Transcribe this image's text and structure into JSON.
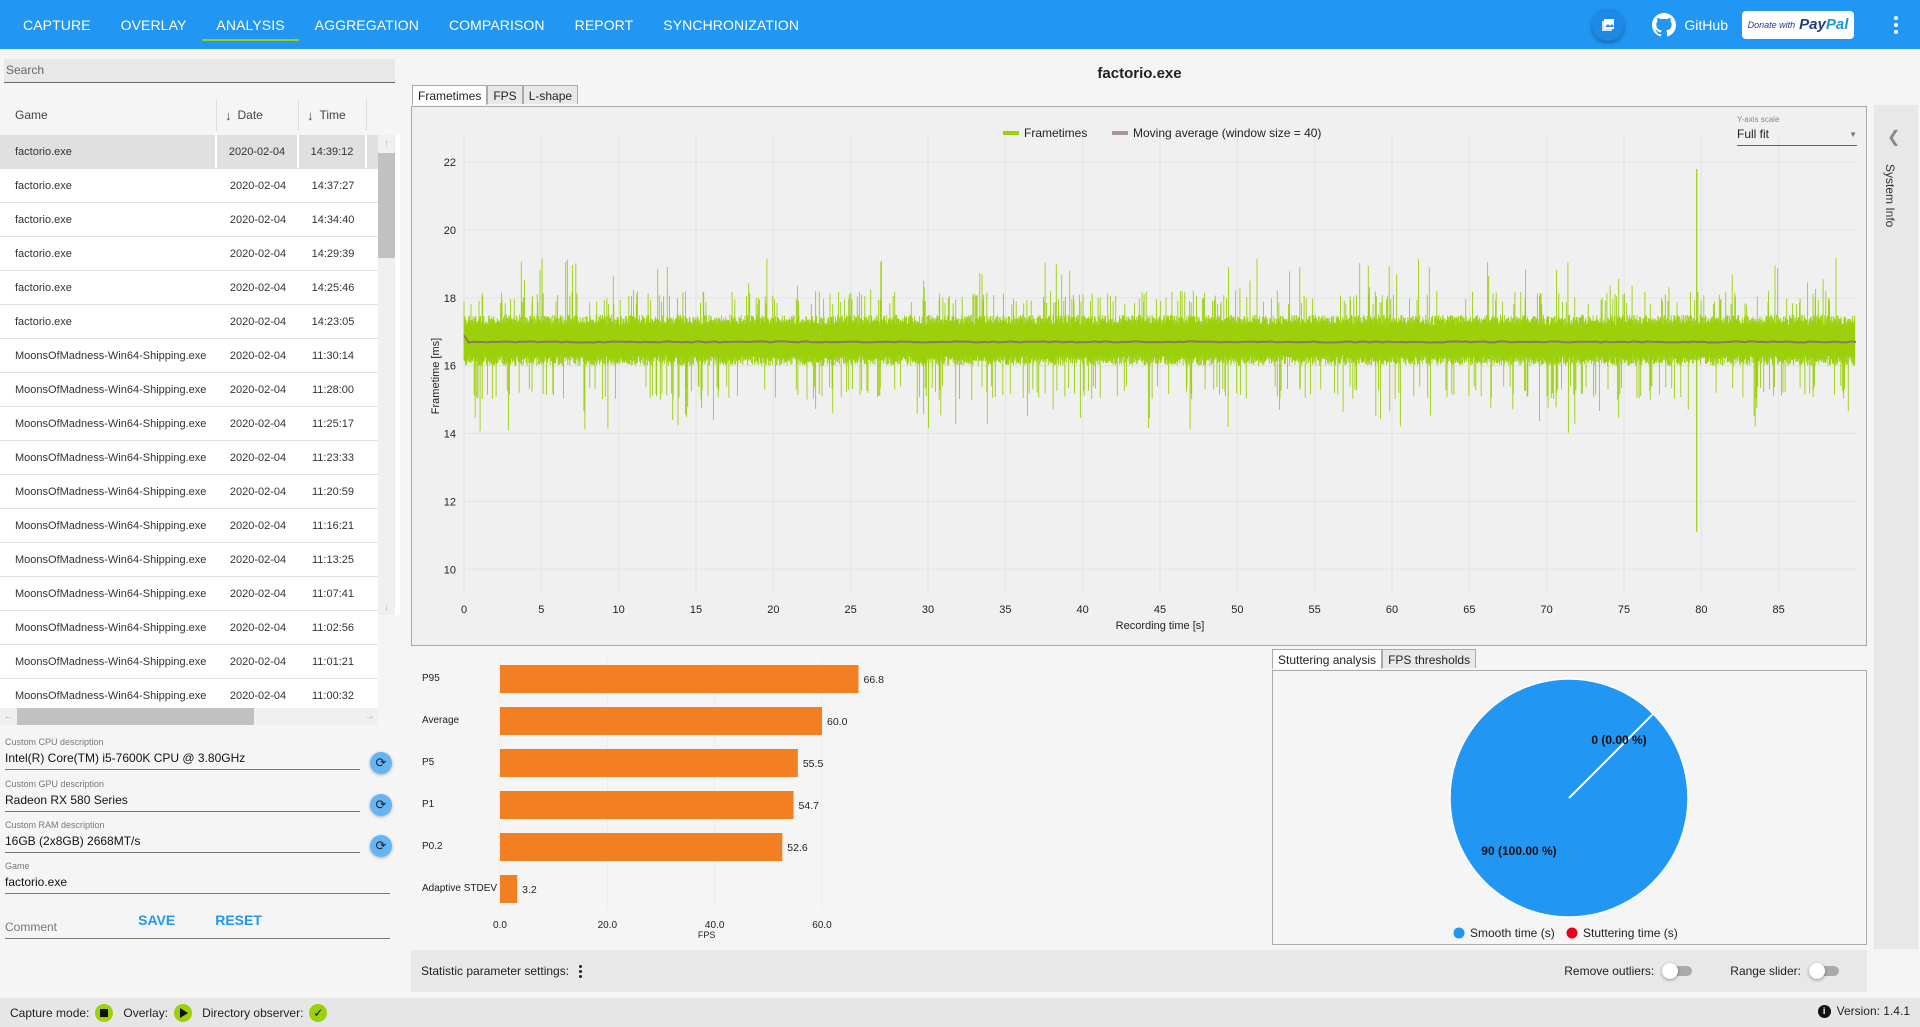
{
  "nav": {
    "items": [
      "CAPTURE",
      "OVERLAY",
      "ANALYSIS",
      "AGGREGATION",
      "COMPARISON",
      "REPORT",
      "SYNCHRONIZATION"
    ],
    "active": "ANALYSIS",
    "github_label": "GitHub",
    "paypal_prefix": "Donate with",
    "paypal_brand_a": "Pay",
    "paypal_brand_b": "Pal"
  },
  "sidebar": {
    "search_placeholder": "Search",
    "columns": {
      "game": "Game",
      "date": "Date",
      "time": "Time"
    },
    "rows": [
      {
        "game": "factorio.exe",
        "date": "2020-02-04",
        "time": "14:39:12",
        "selected": true
      },
      {
        "game": "factorio.exe",
        "date": "2020-02-04",
        "time": "14:37:27"
      },
      {
        "game": "factorio.exe",
        "date": "2020-02-04",
        "time": "14:34:40"
      },
      {
        "game": "factorio.exe",
        "date": "2020-02-04",
        "time": "14:29:39"
      },
      {
        "game": "factorio.exe",
        "date": "2020-02-04",
        "time": "14:25:46"
      },
      {
        "game": "factorio.exe",
        "date": "2020-02-04",
        "time": "14:23:05"
      },
      {
        "game": "MoonsOfMadness-Win64-Shipping.exe",
        "date": "2020-02-04",
        "time": "11:30:14"
      },
      {
        "game": "MoonsOfMadness-Win64-Shipping.exe",
        "date": "2020-02-04",
        "time": "11:28:00"
      },
      {
        "game": "MoonsOfMadness-Win64-Shipping.exe",
        "date": "2020-02-04",
        "time": "11:25:17"
      },
      {
        "game": "MoonsOfMadness-Win64-Shipping.exe",
        "date": "2020-02-04",
        "time": "11:23:33"
      },
      {
        "game": "MoonsOfMadness-Win64-Shipping.exe",
        "date": "2020-02-04",
        "time": "11:20:59"
      },
      {
        "game": "MoonsOfMadness-Win64-Shipping.exe",
        "date": "2020-02-04",
        "time": "11:16:21"
      },
      {
        "game": "MoonsOfMadness-Win64-Shipping.exe",
        "date": "2020-02-04",
        "time": "11:13:25"
      },
      {
        "game": "MoonsOfMadness-Win64-Shipping.exe",
        "date": "2020-02-04",
        "time": "11:07:41"
      },
      {
        "game": "MoonsOfMadness-Win64-Shipping.exe",
        "date": "2020-02-04",
        "time": "11:02:56"
      },
      {
        "game": "MoonsOfMadness-Win64-Shipping.exe",
        "date": "2020-02-04",
        "time": "11:01:21"
      },
      {
        "game": "MoonsOfMadness-Win64-Shipping.exe",
        "date": "2020-02-04",
        "time": "11:00:32"
      }
    ],
    "fields": {
      "cpu_label": "Custom CPU description",
      "cpu_value": "Intel(R) Core(TM) i5-7600K CPU @ 3.80GHz",
      "gpu_label": "Custom GPU description",
      "gpu_value": "Radeon RX 580 Series",
      "ram_label": "Custom RAM description",
      "ram_value": "16GB (2x8GB) 2668MT/s",
      "game_label": "Game",
      "game_value": "factorio.exe",
      "comment_placeholder": "Comment"
    },
    "save_label": "SAVE",
    "reset_label": "RESET"
  },
  "main": {
    "title": "factorio.exe",
    "tabs": [
      "Frametimes",
      "FPS",
      "L-shape"
    ],
    "active_tab": "Frametimes",
    "yscale_label": "Y-axis scale",
    "yscale_value": "Full fit",
    "stutter_tabs": [
      "Stuttering analysis",
      "FPS thresholds"
    ],
    "stat_settings_label": "Statistic parameter settings:",
    "remove_outliers_label": "Remove outliers:",
    "range_slider_label": "Range slider:",
    "remove_outliers_on": false,
    "range_slider_on": false
  },
  "system_info_label": "System Info",
  "status": {
    "capture_mode_label": "Capture mode:",
    "overlay_label": "Overlay:",
    "directory_observer_label": "Directory observer:",
    "version_label": "Version: 1.4.1"
  },
  "colors": {
    "accent": "#2196f3",
    "green": "#9bd00a",
    "orange": "#f28022",
    "moving_avg": "#a89890",
    "stutter": "#e8001c"
  },
  "chart_data": [
    {
      "type": "line",
      "title": "",
      "xlabel": "Recording time [s]",
      "ylabel": "Frametime [ms]",
      "xlim": [
        0,
        90
      ],
      "ylim": [
        9.3,
        22.8
      ],
      "xticks": [
        0,
        5,
        10,
        15,
        20,
        25,
        30,
        35,
        40,
        45,
        50,
        55,
        60,
        65,
        70,
        75,
        80,
        85
      ],
      "yticks": [
        10,
        12,
        14,
        16,
        18,
        20,
        22
      ],
      "grid": true,
      "legend_position": "top-center",
      "series": [
        {
          "name": "Frametimes",
          "description": "noisy band ~16-17.5 ms with spikes 14-19 ms; peak 21.8 ms and dip 11.1 ms near 79.7 s",
          "band": [
            16.0,
            17.5
          ],
          "spike_range": [
            14.0,
            19.2
          ],
          "outliers": [
            [
              79.7,
              21.8
            ],
            [
              79.7,
              11.1
            ]
          ]
        },
        {
          "name": "Moving average (window size = 40)",
          "constant_value": 16.7
        }
      ]
    },
    {
      "type": "bar",
      "orientation": "horizontal",
      "categories": [
        "P95",
        "Average",
        "P5",
        "P1",
        "P0.2",
        "Adaptive STDEV"
      ],
      "values": [
        66.8,
        60.0,
        55.5,
        54.7,
        52.6,
        3.2
      ],
      "xlabel": "FPS",
      "xticks": [
        "0.0",
        "20.0",
        "40.0",
        "60.0"
      ],
      "xlim": [
        0,
        72
      ]
    },
    {
      "type": "pie",
      "labels": [
        "Smooth time (s)",
        "Stuttering time (s)"
      ],
      "values": [
        90,
        0
      ],
      "data_labels": [
        "90 (100.00 %)",
        "0 (0.00 %)"
      ],
      "legend_position": "bottom"
    }
  ]
}
